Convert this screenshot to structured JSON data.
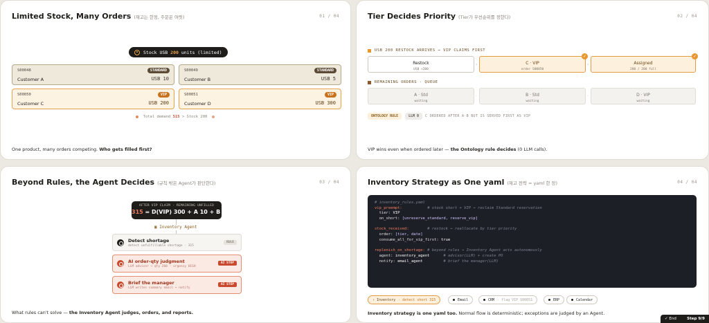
{
  "panel1": {
    "title": "Limited Stock, Many Orders",
    "subtitle": "(재고는 한정, 주문은 여럿)",
    "page": "01 / 04",
    "stock_pill": {
      "prefix": "Stock USB",
      "value": "200",
      "suffix": "units (limited)"
    },
    "orders": [
      {
        "id": "S00048",
        "customer": "Customer A",
        "tier": "STANDARD",
        "qty": "USB 10"
      },
      {
        "id": "S00049",
        "customer": "Customer B",
        "tier": "STANDARD",
        "qty": "USB 5"
      },
      {
        "id": "S00050",
        "customer": "Customer C",
        "tier": "VIP",
        "qty": "USB 200"
      },
      {
        "id": "S00051",
        "customer": "Customer D",
        "tier": "VIP",
        "qty": "USB 300"
      }
    ],
    "demand": {
      "prefix": "Total demand",
      "value": "515",
      "suffix": "> Stock 200"
    },
    "footer_text": "One product, many orders competing.",
    "footer_bold": "Who gets filled first?"
  },
  "panel2": {
    "title": "Tier Decides Priority",
    "subtitle": "(Tier가 우선순위를 정한다)",
    "page": "02 / 04",
    "section1": "USB 200 RESTOCK ARRIVES → VIP CLAIMS FIRST",
    "flow": [
      {
        "title": "Restock",
        "sub": "USB +200"
      },
      {
        "title": "C · VIP",
        "sub": "order S00050"
      },
      {
        "title": "Assigned",
        "sub": "200 / 200 full"
      }
    ],
    "section2": "REMAINING ORDERS · QUEUE",
    "queue": [
      {
        "title": "A · Std",
        "sub": "waiting"
      },
      {
        "title": "B · Std",
        "sub": "waiting"
      },
      {
        "title": "D · VIP",
        "sub": "waiting"
      }
    ],
    "chips": {
      "rule": "ONTOLOGY RULE",
      "llm": "LLM 0",
      "note": "C ORDERED AFTER A·B BUT IS SERVED FIRST AS VIP"
    },
    "footer_text": "VIP wins even when ordered later — ",
    "footer_bold": "the Ontology rule decides",
    "footer_tail": " (0 LLM calls)."
  },
  "panel3": {
    "title": "Beyond Rules, the Agent Decides",
    "subtitle": "(규칙 밖은 Agent가 판단한다)",
    "page": "03 / 04",
    "summary_head": "AFTER VIP CLAIM · REMAINING UNFILLED",
    "summary_value": "315",
    "summary_eq": "= D(VIP) 300 + A 10 + B 5",
    "agent_label": "Inventory Agent",
    "steps": [
      {
        "title": "Detect shortage",
        "sub": "detect unfulfillable shortage · 315",
        "badge": "RULE"
      },
      {
        "title": "AI order-qty judgment",
        "sub": "LLM advisor → qty 260 · urgency HIGH",
        "badge": "AI STEP"
      },
      {
        "title": "Brief the manager",
        "sub": "LLM writes summary email → notify",
        "badge": "AI STEP"
      }
    ],
    "footer_text": "What rules can't solve — ",
    "footer_bold": "the Inventory Agent judges, orders, and reports."
  },
  "panel4": {
    "title": "Inventory Strategy as One yaml",
    "subtitle": "(재고 전략 = yaml 한 장)",
    "page": "04 / 04",
    "code": {
      "l1": "# inventory_rules.yaml",
      "l2k": "vip_preempt:",
      "l2c": "# stock short + VIP → reclaim Standard reservation",
      "l3k": "tier:",
      "l3v": "VIP",
      "l4k": "on_short:",
      "l4v": "[unreserve_standard, reserve_vip]",
      "l6k": "stock_received:",
      "l6c": "# restock → reallocate by tier priority",
      "l7k": "order:",
      "l7v": "[tier, date]",
      "l8k": "consume_all_for_vip_first:",
      "l8v": "true",
      "l10k": "replenish_on_shortage:",
      "l10c": "# beyond rules → Inventory Agent acts autonomously",
      "l11k": "agent:",
      "l11v": "inventory_agent",
      "l11c": "# advisor(LLM) + create PO",
      "l12k": "notify:",
      "l12v": "email_agent",
      "l12c": "# brief the manager(LLM)"
    },
    "tools": [
      {
        "label": "Inventory",
        "detail": "· detect short 315"
      },
      {
        "label": "Email",
        "detail": ""
      },
      {
        "label": "CRM",
        "detail": "· flag VIP S00051"
      },
      {
        "label": "ERP",
        "detail": ""
      },
      {
        "label": "Calendar",
        "detail": ""
      }
    ],
    "footer_bold": "Inventory strategy is one yaml too.",
    "footer_text": " Normal flow is deterministic; exceptions are judged by an Agent."
  },
  "nav": {
    "end": "End",
    "step": "Step 9/9"
  },
  "colors": {
    "accent": "#e8962e",
    "vip": "#c9721e",
    "ai": "#c94a2e",
    "dark": "#1f1d1a"
  }
}
